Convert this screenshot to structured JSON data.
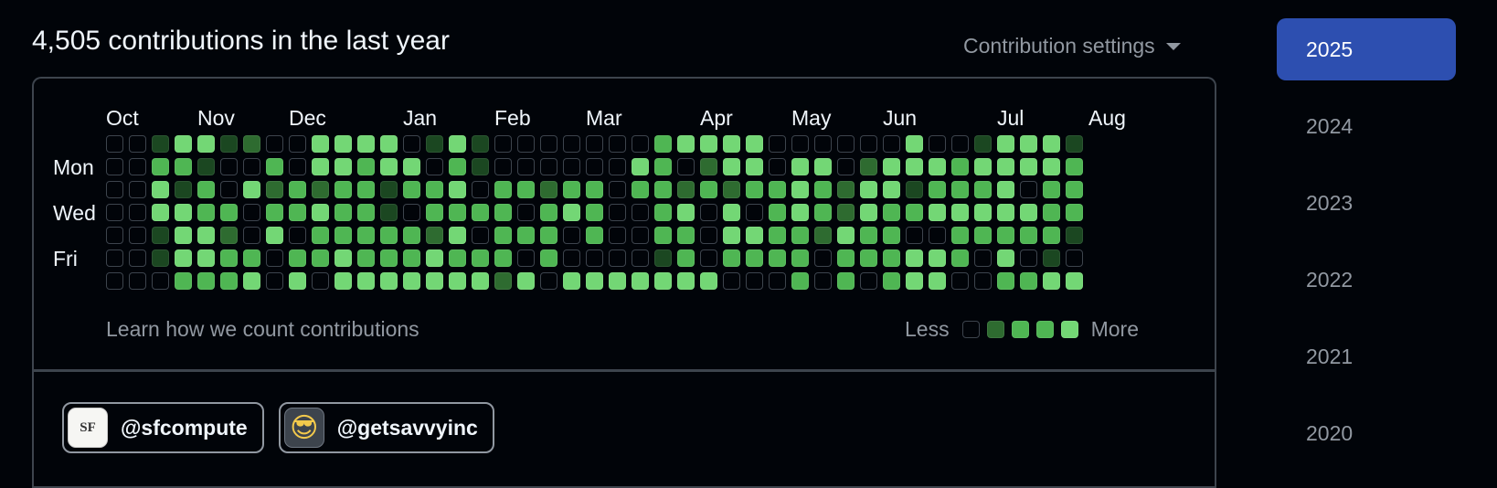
{
  "header": {
    "title": "4,505 contributions in the last year",
    "settings_label": "Contribution settings"
  },
  "graph": {
    "months": [
      "Oct",
      "Nov",
      "Dec",
      "Jan",
      "Feb",
      "Mar",
      "Apr",
      "May",
      "Jun",
      "Jul",
      "Aug"
    ],
    "month_week_index": [
      0,
      4,
      8,
      13,
      17,
      21,
      26,
      30,
      34,
      39,
      43
    ],
    "days": [
      "Mon",
      "Wed",
      "Fri"
    ],
    "day_row_index": [
      1,
      3,
      5
    ],
    "weeks": 46,
    "levels": [
      "0014412004444014100000003444400000040014441",
      "0033100304434403100000043024404402444344443",
      "0041304232331334033233033232334324413334033",
      "0044330334331033330343003404034324334444433",
      "0014420403333324033303003304433243300333331",
      "0014433033433343330300001303333033344304010",
      "0003334040444444424044444440003030344003344"
    ],
    "colors": {
      "empty": "#010409",
      "empty_border": "#3d444d",
      "l1": "#1b4721",
      "l2": "#2e6b30",
      "l3": "#4fb653",
      "l4": "#73d775"
    }
  },
  "footer": {
    "learn_link": "Learn how we count contributions",
    "less_label": "Less",
    "more_label": "More"
  },
  "orgs": [
    {
      "handle": "@sfcompute",
      "avatar_text": "SF"
    },
    {
      "handle": "@getsavvyinc",
      "avatar_text": "😎"
    }
  ],
  "years": [
    "2025",
    "2024",
    "2023",
    "2022",
    "2021",
    "2020"
  ],
  "active_year": "2025"
}
